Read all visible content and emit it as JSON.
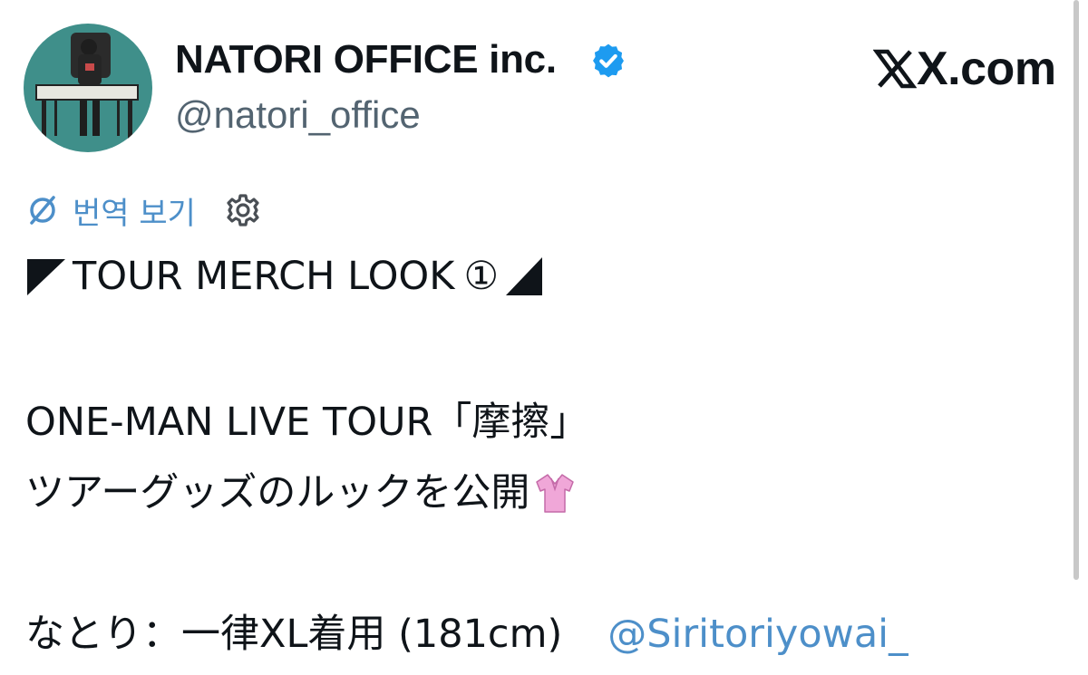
{
  "post": {
    "author": {
      "display_name": "NATORI OFFICE inc.",
      "handle": "@natori_office",
      "verified": true,
      "avatar_icon": "avatar-illustration"
    },
    "source_logo": "X.com",
    "translate": {
      "label": "번역 보기",
      "icon": "translate-slash-icon",
      "settings_icon": "gear-icon"
    },
    "body": {
      "line1": {
        "text": "TOUR MERCH LOOK",
        "circled_number": "①"
      },
      "line2": "ONE-MAN LIVE TOUR「摩擦」",
      "line3": "ツアーグッズのルックを公開",
      "line3_emoji": "blouse-icon",
      "line4": "なとり：一律XL着用 (181cm)",
      "mention": "@Siritoriyowai_"
    }
  },
  "colors": {
    "text": "#0f1419",
    "secondary": "#536471",
    "link": "#4d8fc9",
    "verified": "#1d9bf0"
  }
}
